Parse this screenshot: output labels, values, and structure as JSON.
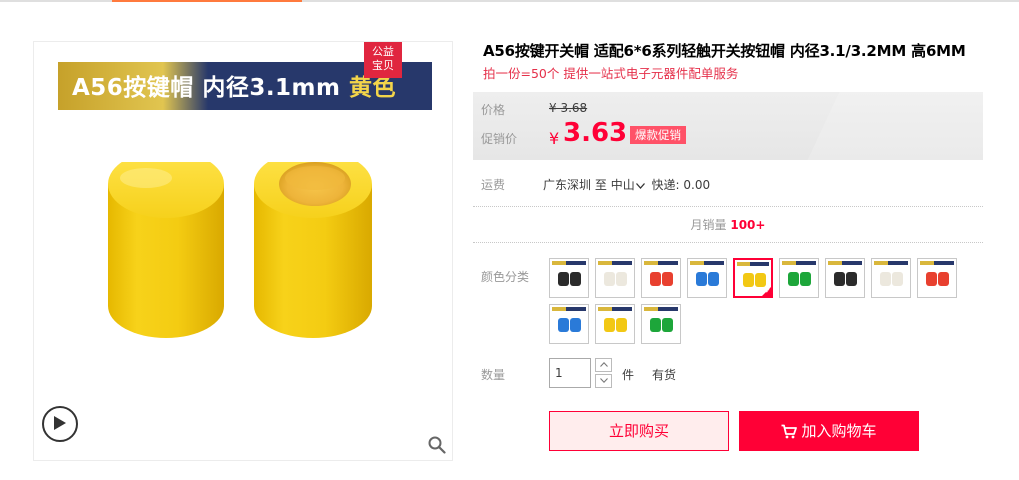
{
  "gallery": {
    "banner_left": "A56按键帽 内径3.1mm ",
    "banner_highlight": "黄色",
    "charity_badge": "公益\n宝贝",
    "charity_line1": "公益",
    "charity_line2": "宝贝",
    "product_color": "#f5cd10",
    "icons": {
      "play": "play-icon",
      "zoom": "magnifier-icon"
    }
  },
  "product": {
    "title": "A56按键开关帽 适配6*6系列轻触开关按钮帽 内径3.1/3.2MM 高6MM",
    "subtitle": "拍一份=50个 提供一站式电子元器件配单服务"
  },
  "price": {
    "original_label": "价格",
    "original_value": "¥ 3.68",
    "sale_label": "促销价",
    "currency": "¥",
    "sale_value": "3.63",
    "promo_tag": "爆款促销"
  },
  "shipping": {
    "label": "运费",
    "from": "广东深圳",
    "to_word": "至",
    "destination": "中山",
    "express": "快递: 0.00"
  },
  "sales": {
    "label": "月销量",
    "value": "100+"
  },
  "colors": {
    "label": "颜色分类",
    "selected_index": 4,
    "swatches": [
      {
        "name": "black",
        "color": "#2b2b2b"
      },
      {
        "name": "white",
        "color": "#ece8de"
      },
      {
        "name": "red",
        "color": "#e8402f"
      },
      {
        "name": "blue",
        "color": "#2a7ad8"
      },
      {
        "name": "yellow",
        "color": "#f2c814"
      },
      {
        "name": "green",
        "color": "#1da63a"
      },
      {
        "name": "black",
        "color": "#2b2b2b"
      },
      {
        "name": "white",
        "color": "#ece8de"
      },
      {
        "name": "red",
        "color": "#e8402f"
      },
      {
        "name": "blue",
        "color": "#2a7ad8"
      },
      {
        "name": "yellow",
        "color": "#f2c814"
      },
      {
        "name": "green",
        "color": "#1da63a"
      }
    ]
  },
  "quantity": {
    "label": "数量",
    "value": "1",
    "unit": "件",
    "stock": "有货"
  },
  "actions": {
    "buy_now": "立即购买",
    "add_to_cart": "加入购物车"
  }
}
